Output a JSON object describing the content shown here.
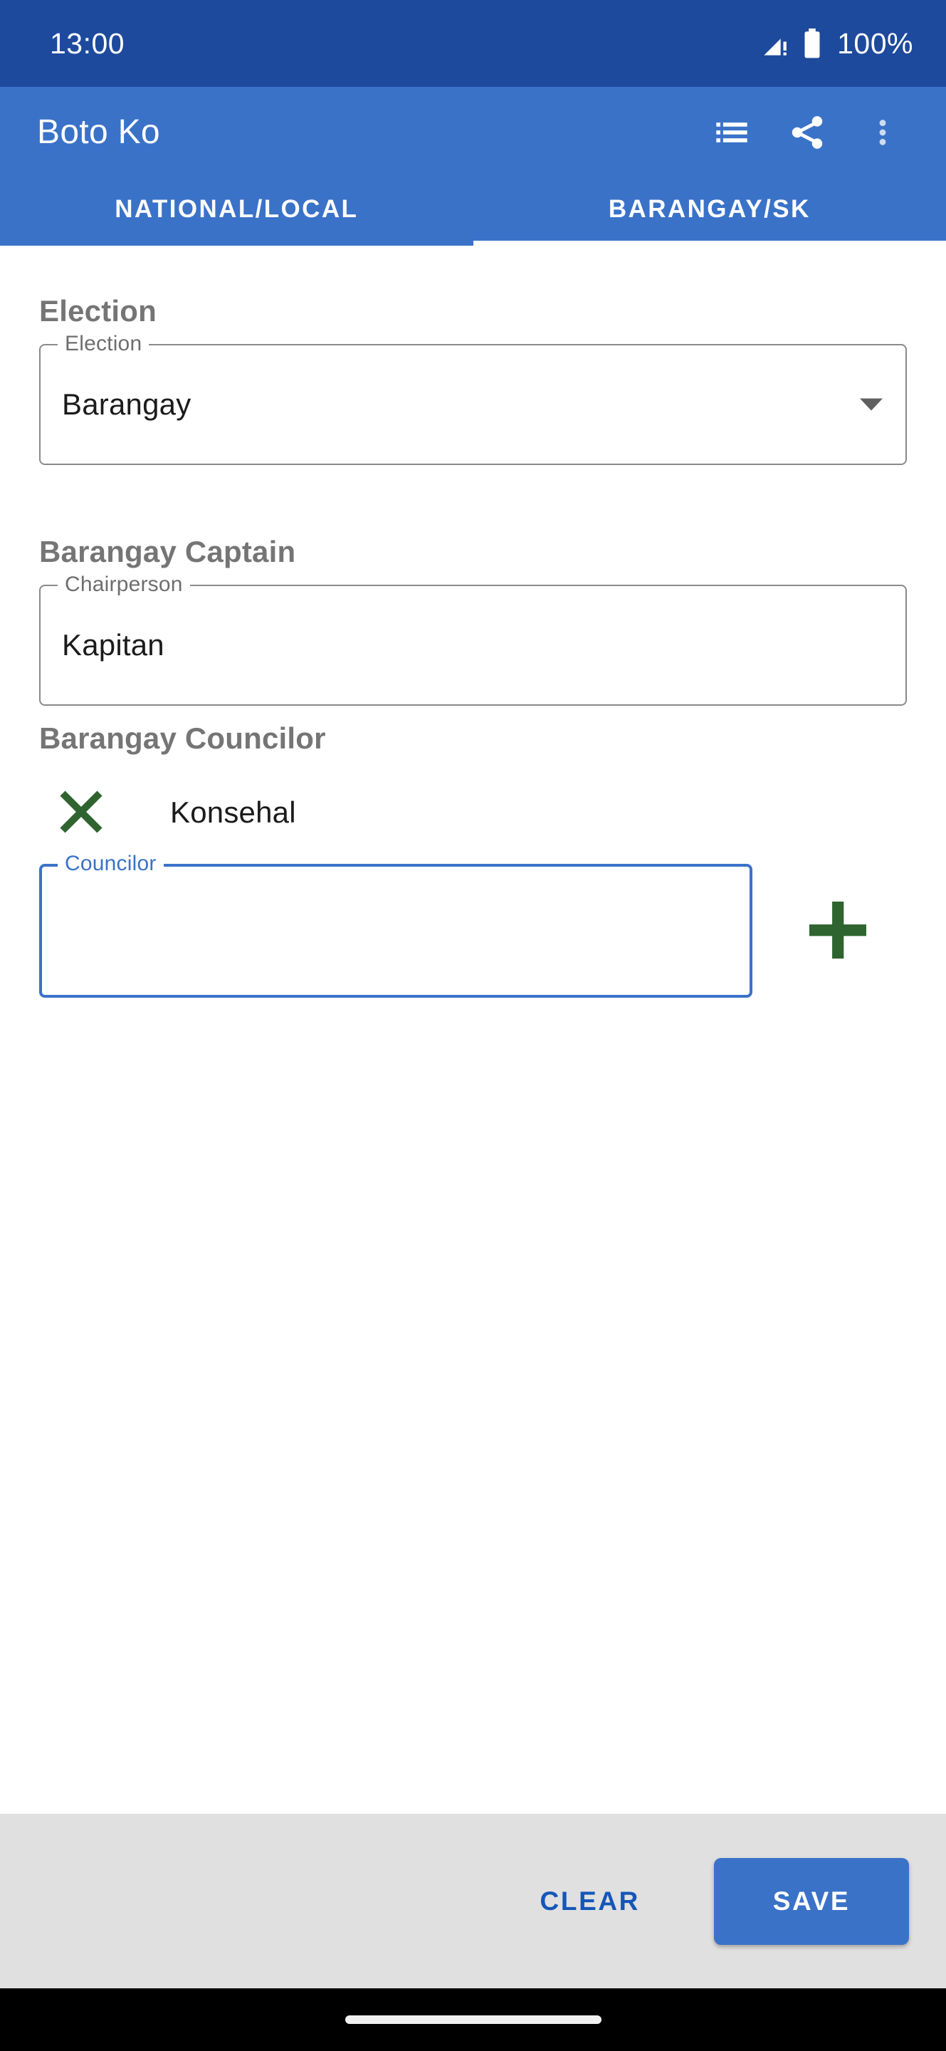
{
  "status_bar": {
    "clock": "13:00",
    "battery_percent": "100%",
    "signal_icon": "signal-cellular-alert-icon",
    "battery_icon": "battery-full-icon",
    "background_color": "#1d4a9c"
  },
  "app_bar": {
    "title": "Boto Ko",
    "background_color": "#3a72c8",
    "actions": [
      {
        "name": "list-icon",
        "label": "List"
      },
      {
        "name": "share-icon",
        "label": "Share"
      },
      {
        "name": "overflow-menu-icon",
        "label": "More options"
      }
    ]
  },
  "tabs": {
    "items": [
      {
        "label": "NATIONAL/LOCAL",
        "active": false
      },
      {
        "label": "BARANGAY/SK",
        "active": true
      }
    ],
    "active_index": 1,
    "indicator_color": "#ffffff"
  },
  "sections": {
    "election": {
      "heading": "Election",
      "field": {
        "label": "Election",
        "value": "Barangay",
        "type": "dropdown",
        "focused": false,
        "arrow_icon": "chevron-down-icon"
      }
    },
    "captain": {
      "heading": "Barangay Captain",
      "field": {
        "label": "Chairperson",
        "value": "Kapitan",
        "type": "text",
        "focused": false
      }
    },
    "councilor": {
      "heading": "Barangay Councilor",
      "entries": [
        {
          "name": "Konsehal",
          "remove_icon": "close-x-icon"
        }
      ],
      "field": {
        "label": "Councilor",
        "value": "",
        "placeholder": "",
        "type": "text",
        "focused": true
      },
      "add_button": {
        "icon": "plus-icon",
        "label": "Add councilor"
      }
    }
  },
  "bottom_bar": {
    "clear_label": "CLEAR",
    "save_label": "SAVE",
    "background_color": "#e0e0e0",
    "clear_color": "#1556b8",
    "save_color": "#3a72c8"
  },
  "nav_bar": {
    "gesture_pill": "home-indicator"
  },
  "colors": {
    "status_bar": "#1d4a9c",
    "primary": "#3a72c8",
    "accent_green": "#2f6430",
    "heading_gray": "#757575",
    "field_border": "#8a8a8a"
  }
}
